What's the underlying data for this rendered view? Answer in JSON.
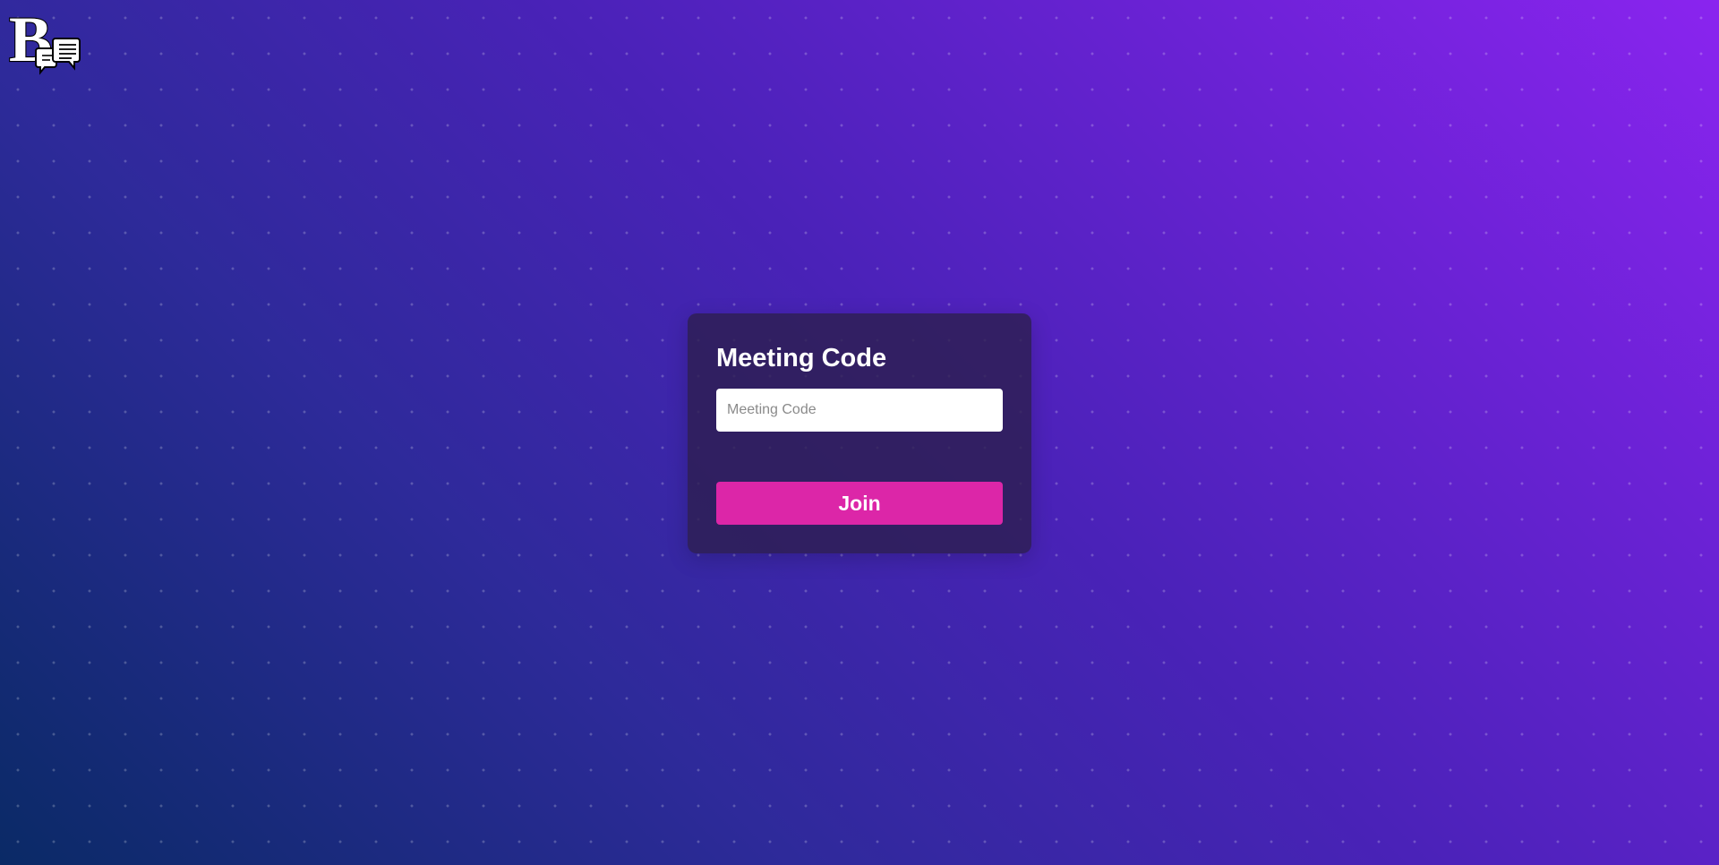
{
  "logo": {
    "icon": "b-chat-logo-icon",
    "letter": "B"
  },
  "card": {
    "title": "Meeting Code",
    "input": {
      "placeholder": "Meeting Code",
      "value": ""
    },
    "join_label": "Join"
  },
  "colors": {
    "gradient_start": "#0a2a66",
    "gradient_end": "#8a24ef",
    "card_background": "#2d1e50",
    "join_button": "#dc26a8",
    "title_text": "#ffffff"
  }
}
